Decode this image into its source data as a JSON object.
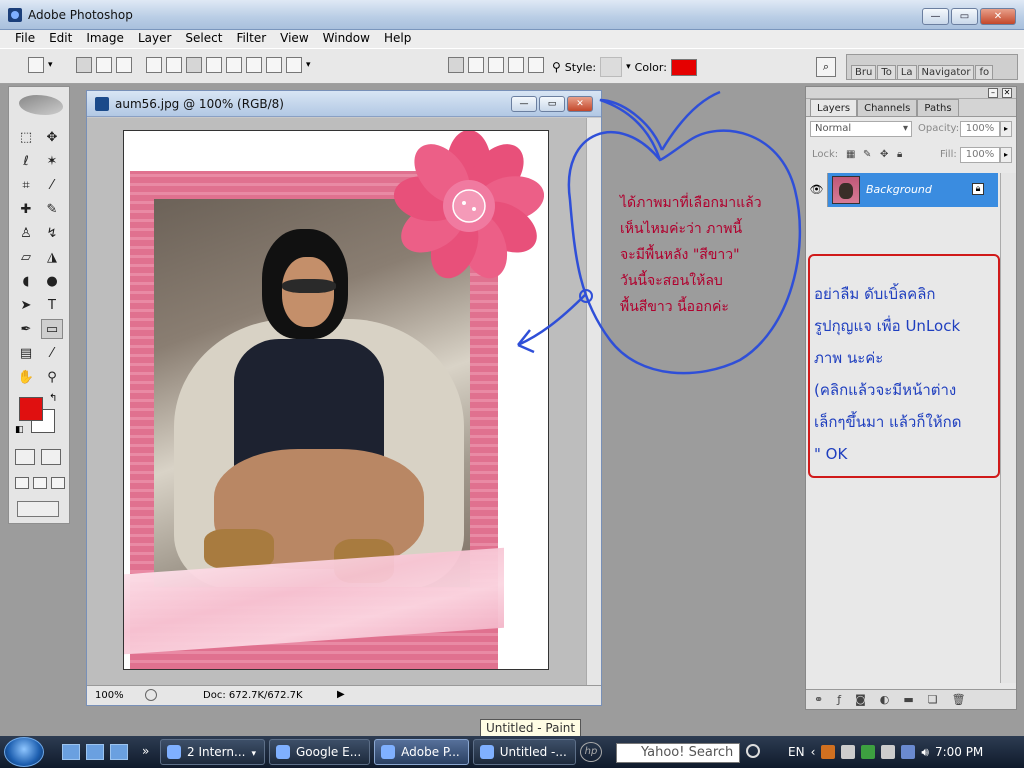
{
  "app": {
    "title": "Adobe Photoshop",
    "menu": [
      "File",
      "Edit",
      "Image",
      "Layer",
      "Select",
      "Filter",
      "View",
      "Window",
      "Help"
    ]
  },
  "options_bar": {
    "style_label": "Style:",
    "color_label": "Color:",
    "color_value": "#e50000",
    "palette_tabs": [
      "Bru",
      "To",
      "La",
      "Navigator",
      "fo"
    ]
  },
  "document": {
    "title": "aum56.jpg @ 100% (RGB/8)",
    "zoom": "100%",
    "doc_size": "Doc: 672.7K/672.7K"
  },
  "annotations": {
    "note1": [
      "ได้ภาพมาที่เลือกมาแล้ว",
      "เห็นไหมค่ะว่า ภาพนี้",
      "จะมีพื้นหลัง \"สีขาว\"",
      "วันนี้จะสอนให้ลบ",
      "พื้นสีขาว นี้ออกค่ะ"
    ],
    "note2": [
      "อย่าลืม ดับเบิ้ลคลิก",
      "รูปกุญแจ เพื่อ UnLock",
      "ภาพ นะค่ะ",
      "(คลิกแล้วจะมีหน้าต่าง",
      "เล็กๆขึ้นมา แล้วก็ให้กด",
      "\" OK"
    ]
  },
  "layers_panel": {
    "tabs": [
      "Layers",
      "Channels",
      "Paths"
    ],
    "blend_mode": "Normal",
    "opacity_label": "Opacity:",
    "opacity": "100%",
    "lock_label": "Lock:",
    "fill_label": "Fill:",
    "fill": "100%",
    "layer_name": "Background"
  },
  "taskbar": {
    "tasks": [
      "2 Intern...",
      "Google E...",
      "Adobe P...",
      "Untitled -..."
    ],
    "search_placeholder": "Yahoo! Search",
    "lang": "EN",
    "time": "7:00 PM",
    "tooltip": "Untitled - Paint"
  },
  "colors": {
    "foreground": "#e01010",
    "background": "#ffffff",
    "annotation_blue": "#1f3fbf",
    "annotation_red": "#d01a1a",
    "layer_selected": "#3a8ce0"
  }
}
